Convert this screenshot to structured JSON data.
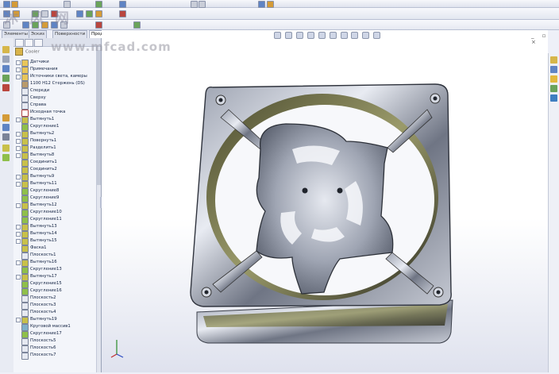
{
  "tabs": [
    {
      "label": "Элементы",
      "active": false
    },
    {
      "label": "Эскиз",
      "active": false
    },
    {
      "label": "Поверхности",
      "active": false
    },
    {
      "label": "Продукты Office",
      "active": true
    }
  ],
  "watermark": {
    "top": "沐风网",
    "url": "www.mfcad.com"
  },
  "tree": {
    "root": "Cooler",
    "items": [
      {
        "label": "Датчики",
        "icon": "folder-icon",
        "expandable": true
      },
      {
        "label": "Примечания",
        "icon": "folder-icon",
        "expandable": true
      },
      {
        "label": "Источники света, камеры",
        "icon": "folder-icon",
        "expandable": true
      },
      {
        "label": "1100 Н12 Стержень (DS)",
        "icon": "material-icon",
        "expandable": false
      },
      {
        "label": "Спереди",
        "icon": "plane-icon",
        "expandable": false
      },
      {
        "label": "Сверху",
        "icon": "plane-icon",
        "expandable": false
      },
      {
        "label": "Справа",
        "icon": "plane-icon",
        "expandable": false
      },
      {
        "label": "Исходная точка",
        "icon": "origin-icon",
        "expandable": false
      },
      {
        "label": "Вытянуть1",
        "icon": "feature-icon",
        "expandable": true
      },
      {
        "label": "Скругление1",
        "icon": "fillet-icon",
        "expandable": false
      },
      {
        "label": "Вытянуть2",
        "icon": "feature-icon",
        "expandable": true
      },
      {
        "label": "Повернуть1",
        "icon": "feature-icon",
        "expandable": true
      },
      {
        "label": "Разделить1",
        "icon": "feature-icon",
        "expandable": true
      },
      {
        "label": "Вытянуть8",
        "icon": "feature-icon",
        "expandable": true
      },
      {
        "label": "Соединить1",
        "icon": "feature-icon",
        "expandable": false
      },
      {
        "label": "Соединить2",
        "icon": "feature-icon",
        "expandable": false
      },
      {
        "label": "Вытянуть9",
        "icon": "feature-icon",
        "expandable": true
      },
      {
        "label": "Вытянуть11",
        "icon": "feature-icon",
        "expandable": true
      },
      {
        "label": "Скругление8",
        "icon": "fillet-icon",
        "expandable": false
      },
      {
        "label": "Скругление9",
        "icon": "fillet-icon",
        "expandable": false
      },
      {
        "label": "Вытянуть12",
        "icon": "feature-icon",
        "expandable": true
      },
      {
        "label": "Скругление10",
        "icon": "fillet-icon",
        "expandable": false
      },
      {
        "label": "Скругление11",
        "icon": "fillet-icon",
        "expandable": false
      },
      {
        "label": "Вытянуть13",
        "icon": "feature-icon",
        "expandable": true
      },
      {
        "label": "Вытянуть14",
        "icon": "feature-icon",
        "expandable": true
      },
      {
        "label": "Вытянуть15",
        "icon": "feature-icon",
        "expandable": true
      },
      {
        "label": "Фаска1",
        "icon": "feature-icon",
        "expandable": false
      },
      {
        "label": "Плоскость1",
        "icon": "plane-icon",
        "expandable": false
      },
      {
        "label": "Вытянуть16",
        "icon": "feature-icon",
        "expandable": true
      },
      {
        "label": "Скругление13",
        "icon": "fillet-icon",
        "expandable": false
      },
      {
        "label": "Вытянуть17",
        "icon": "feature-icon",
        "expandable": true
      },
      {
        "label": "Скругление15",
        "icon": "fillet-icon",
        "expandable": false
      },
      {
        "label": "Скругление16",
        "icon": "fillet-icon",
        "expandable": false
      },
      {
        "label": "Плоскость2",
        "icon": "plane-icon",
        "expandable": false
      },
      {
        "label": "Плоскость3",
        "icon": "plane-icon",
        "expandable": false
      },
      {
        "label": "Плоскость4",
        "icon": "plane-icon",
        "expandable": false
      },
      {
        "label": "Вытянуть19",
        "icon": "feature-icon",
        "expandable": true
      },
      {
        "label": "Круговой массив1",
        "icon": "pattern-icon",
        "expandable": false
      },
      {
        "label": "Скругление17",
        "icon": "fillet-icon",
        "expandable": false
      },
      {
        "label": "Плоскость5",
        "icon": "plane-icon",
        "expandable": false
      },
      {
        "label": "Плоскость6",
        "icon": "plane-icon",
        "expandable": false
      },
      {
        "label": "Плоскость7",
        "icon": "plane-icon",
        "expandable": false
      }
    ]
  },
  "window_controls": "_ ▫ ×",
  "colors": {
    "accent": "#5f84c4",
    "viewport_bottom": "#dfe2ee",
    "panel_bg": "#f3f5fa"
  }
}
